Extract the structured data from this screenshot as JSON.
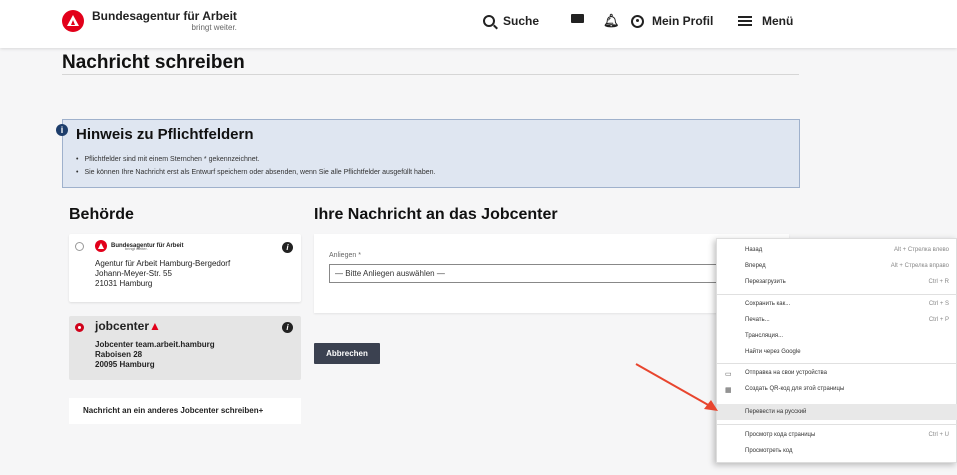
{
  "header": {
    "logo_title": "Bundesagentur für Arbeit",
    "logo_tagline": "bringt weiter.",
    "search": "Suche",
    "profile": "Mein Profil",
    "menu": "Menü"
  },
  "page": {
    "title": "Nachricht schreiben"
  },
  "notice": {
    "title": "Hinweis zu Pflichtfeldern",
    "items": [
      "Pflichtfelder sind mit einem Sternchen * gekennzeichnet.",
      "Sie können Ihre Nachricht erst als Entwurf speichern oder absenden, wenn Sie alle Pflichtfelder ausgefüllt haben."
    ]
  },
  "behoerde": {
    "title": "Behörde",
    "cards": [
      {
        "logo_title": "Bundesagentur für Arbeit",
        "logo_tagline": "bringt weiter.",
        "lines": [
          "Agentur für Arbeit Hamburg-Bergedorf",
          "Johann-Meyer-Str. 55",
          "21031 Hamburg"
        ]
      },
      {
        "logo_prefix": "jobcenter",
        "lines": [
          "Jobcenter team.arbeit.hamburg",
          "Raboisen 28",
          "20095 Hamburg"
        ]
      }
    ],
    "other_link": "Nachricht an ein anderes Jobcenter schreiben+"
  },
  "message": {
    "title": "Ihre Nachricht an das Jobcenter",
    "anliegen_label": "Anliegen *",
    "anliegen_value": "— Bitte Anliegen auswählen —",
    "cancel": "Abbrechen"
  },
  "context_menu": {
    "items": [
      {
        "label": "Назад",
        "shortcut": "Alt + Стрелка влево"
      },
      {
        "label": "Вперед",
        "shortcut": "Alt + Стрелка вправо"
      },
      {
        "label": "Перезагрузить",
        "shortcut": "Ctrl + R"
      },
      {
        "label": "Сохранить как...",
        "shortcut": "Ctrl + S"
      },
      {
        "label": "Печать...",
        "shortcut": "Ctrl + P"
      },
      {
        "label": "Трансляция..."
      },
      {
        "label": "Найти через Google"
      },
      {
        "label": "Отправка на свои устройства"
      },
      {
        "label": "Создать QR-код для этой страницы"
      },
      {
        "label": "Перевести на русский"
      },
      {
        "label": "Просмотр кода страницы",
        "shortcut": "Ctrl + U"
      },
      {
        "label": "Просмотреть код"
      }
    ]
  },
  "colors": {
    "brand_red": "#e2001a",
    "notice_bg": "#dfe6f1",
    "button_dark": "#3b4150",
    "arrow": "#e8452e"
  }
}
